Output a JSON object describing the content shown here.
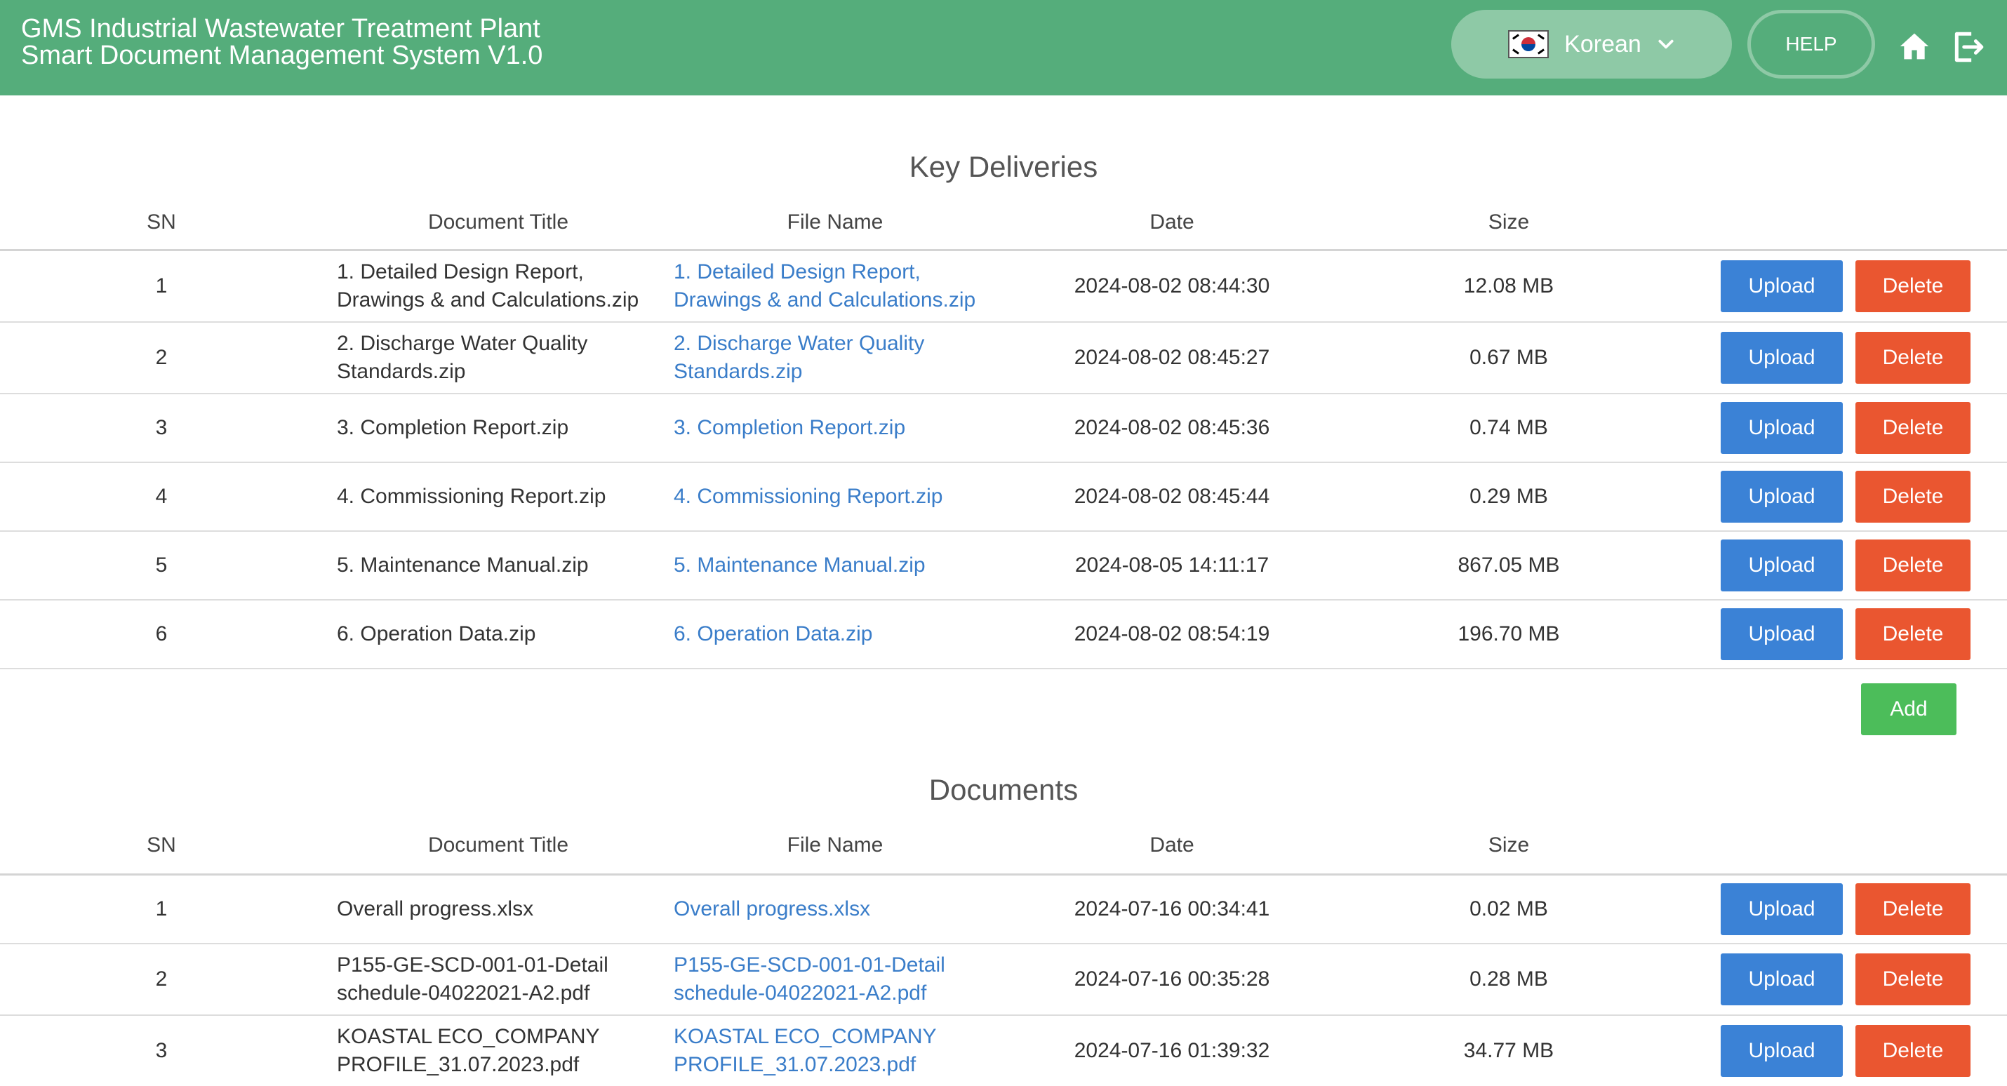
{
  "header": {
    "title_line1": "GMS Industrial Wastewater Treatment Plant",
    "title_line2": "Smart Document Management System V1.0",
    "language": "Korean",
    "help_label": "HELP",
    "bg_color": "#55ad7b"
  },
  "key_deliveries": {
    "title": "Key Deliveries",
    "columns": {
      "sn": "SN",
      "title": "Document Title",
      "file": "File Name",
      "date": "Date",
      "size": "Size"
    },
    "rows": [
      {
        "sn": "1",
        "title": "1. Detailed Design Report, Drawings & and Calculations.zip",
        "file": "1. Detailed Design Report, Drawings & and Calculations.zip",
        "date": "2024-08-02 08:44:30",
        "size": "12.08 MB"
      },
      {
        "sn": "2",
        "title": "2. Discharge Water Quality Standards.zip",
        "file": "2. Discharge Water Quality Standards.zip",
        "date": "2024-08-02 08:45:27",
        "size": "0.67 MB"
      },
      {
        "sn": "3",
        "title": "3. Completion Report.zip",
        "file": "3. Completion Report.zip",
        "date": "2024-08-02 08:45:36",
        "size": "0.74 MB"
      },
      {
        "sn": "4",
        "title": "4. Commissioning Report.zip",
        "file": "4. Commissioning Report.zip",
        "date": "2024-08-02 08:45:44",
        "size": "0.29 MB"
      },
      {
        "sn": "5",
        "title": "5. Maintenance Manual.zip",
        "file": "5. Maintenance Manual.zip",
        "date": "2024-08-05 14:11:17",
        "size": "867.05 MB"
      },
      {
        "sn": "6",
        "title": "6. Operation Data.zip",
        "file": "6. Operation Data.zip",
        "date": "2024-08-02 08:54:19",
        "size": "196.70 MB"
      }
    ],
    "add_label": "Add"
  },
  "documents": {
    "title": "Documents",
    "columns": {
      "sn": "SN",
      "title": "Document Title",
      "file": "File Name",
      "date": "Date",
      "size": "Size"
    },
    "rows": [
      {
        "sn": "1",
        "title": "Overall progress.xlsx",
        "file": "Overall progress.xlsx",
        "date": "2024-07-16 00:34:41",
        "size": "0.02 MB"
      },
      {
        "sn": "2",
        "title": "P155-GE-SCD-001-01-Detail schedule-04022021-A2.pdf",
        "file": "P155-GE-SCD-001-01-Detail schedule-04022021-A2.pdf",
        "date": "2024-07-16 00:35:28",
        "size": "0.28 MB"
      },
      {
        "sn": "3",
        "title": "KOASTAL ECO_COMPANY PROFILE_31.07.2023.pdf",
        "file": "KOASTAL ECO_COMPANY PROFILE_31.07.2023.pdf",
        "date": "2024-07-16 01:39:32",
        "size": "34.77 MB"
      }
    ]
  },
  "actions": {
    "upload_label": "Upload",
    "delete_label": "Delete"
  },
  "icons": {
    "language": "korea-flag-icon",
    "dropdown": "chevron-down-icon",
    "home": "home-icon",
    "logout": "logout-icon"
  }
}
